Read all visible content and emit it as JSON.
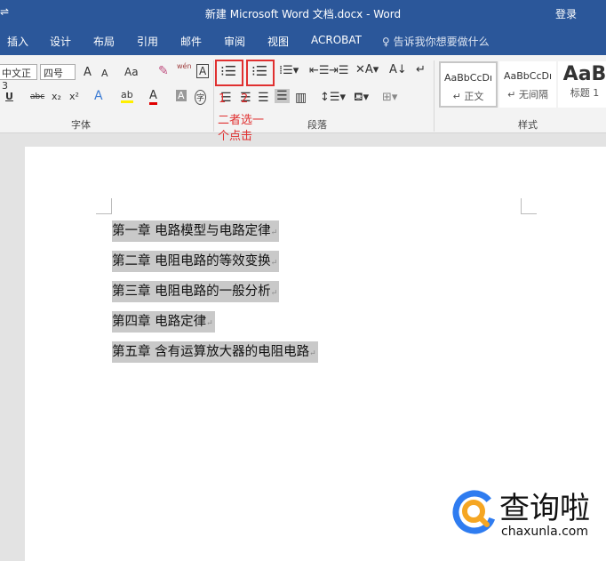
{
  "titlebar": {
    "title": "新建 Microsoft Word 文档.docx  -  Word",
    "login": "登录",
    "quick_access": "⇌"
  },
  "tabs": [
    {
      "label": "插入"
    },
    {
      "label": "设计"
    },
    {
      "label": "布局"
    },
    {
      "label": "引用"
    },
    {
      "label": "邮件"
    },
    {
      "label": "审阅"
    },
    {
      "label": "视图"
    },
    {
      "label": "ACROBAT"
    }
  ],
  "tell_me": "告诉我你想要做什么",
  "ribbon": {
    "font_name": "中文正3",
    "font_size": "四号",
    "grow": "A",
    "shrink": "A",
    "case": "Aa",
    "phonetic": "wén",
    "border_char": "A",
    "underline": "U",
    "strike": "abc",
    "sub": "x₂",
    "sup": "x²",
    "text_effect": "A",
    "highlight": "ab",
    "font_color": "A",
    "shading": "A",
    "enclose": "字",
    "group_font": "字体",
    "group_paragraph": "段落",
    "group_styles": "样式",
    "styles": [
      {
        "preview": "AaBbCcDı",
        "name": "↵ 正文"
      },
      {
        "preview": "AaBbCcDı",
        "name": "↵ 无间隔"
      },
      {
        "preview": "AaB",
        "name": "标题 1"
      }
    ]
  },
  "annotation": {
    "num1": "1",
    "num2": "2",
    "text_line1": "二者选一",
    "text_line2": "个点击",
    "color": "#e03030"
  },
  "document": {
    "lines": [
      "第一章  电路模型与电路定律",
      "第二章  电阻电路的等效变换",
      "第三章  电阻电路的一般分析",
      "第四章  电路定律",
      "第五章  含有运算放大器的电阻电路"
    ],
    "para_mark": "↵"
  },
  "watermark": {
    "name": "查询啦",
    "domain": "chaxunla.com"
  },
  "colors": {
    "title_blue": "#2b579a",
    "highlight": "#c9c9c9"
  }
}
